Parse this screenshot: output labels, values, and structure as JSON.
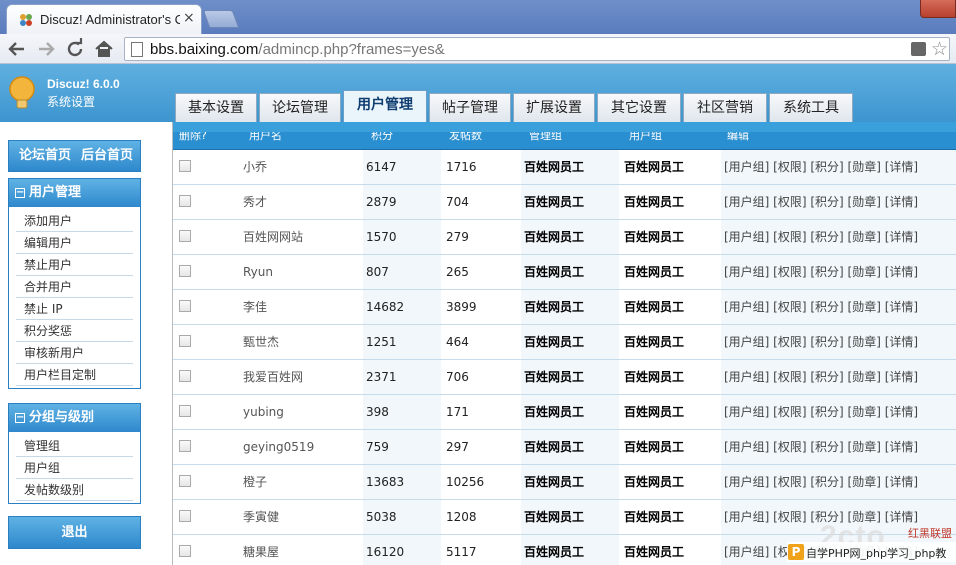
{
  "browser": {
    "tab_title": "Discuz! Administrator's Co",
    "close_glyph": "×",
    "url_host": "bbs.baixing.com",
    "url_path": "/admincp.php?frames=yes&"
  },
  "header": {
    "product": "Discuz! 6.0.0",
    "subtitle": "系统设置",
    "tabs": [
      "基本设置",
      "论坛管理",
      "用户管理",
      "帖子管理",
      "扩展设置",
      "其它设置",
      "社区营销",
      "系统工具"
    ],
    "active_tab": "用户管理"
  },
  "sidebar": {
    "quick_links": [
      "论坛首页",
      "后台首页"
    ],
    "groups": [
      {
        "title": "用户管理",
        "items": [
          "添加用户",
          "编辑用户",
          "禁止用户",
          "合并用户",
          "禁止 IP",
          "积分奖惩",
          "审核新用户",
          "用户栏目定制"
        ]
      },
      {
        "title": "分组与级别",
        "items": [
          "管理组",
          "用户组",
          "发帖数级别"
        ]
      }
    ],
    "logout": "退出"
  },
  "table": {
    "headers": [
      "删除?",
      "用户名",
      "积分",
      "发帖数",
      "管理组",
      "用户组",
      "编辑"
    ],
    "edit_links": "[用户组] [权限] [积分] [勋章] [详情]",
    "rows": [
      {
        "name": "小乔",
        "credits": "6147",
        "posts": "1716",
        "admin_group": "百姓网员工",
        "user_group": "百姓网员工"
      },
      {
        "name": "秀才",
        "credits": "2879",
        "posts": "704",
        "admin_group": "百姓网员工",
        "user_group": "百姓网员工"
      },
      {
        "name": "百姓网网站",
        "credits": "1570",
        "posts": "279",
        "admin_group": "百姓网员工",
        "user_group": "百姓网员工"
      },
      {
        "name": "Ryun",
        "credits": "807",
        "posts": "265",
        "admin_group": "百姓网员工",
        "user_group": "百姓网员工"
      },
      {
        "name": "李佳",
        "credits": "14682",
        "posts": "3899",
        "admin_group": "百姓网员工",
        "user_group": "百姓网员工"
      },
      {
        "name": "甄世杰",
        "credits": "1251",
        "posts": "464",
        "admin_group": "百姓网员工",
        "user_group": "百姓网员工"
      },
      {
        "name": "我爱百姓网",
        "credits": "2371",
        "posts": "706",
        "admin_group": "百姓网员工",
        "user_group": "百姓网员工"
      },
      {
        "name": "yubing",
        "credits": "398",
        "posts": "171",
        "admin_group": "百姓网员工",
        "user_group": "百姓网员工"
      },
      {
        "name": "geying0519",
        "credits": "759",
        "posts": "297",
        "admin_group": "百姓网员工",
        "user_group": "百姓网员工"
      },
      {
        "name": "橙子",
        "credits": "13683",
        "posts": "10256",
        "admin_group": "百姓网员工",
        "user_group": "百姓网员工"
      },
      {
        "name": "季寅健",
        "credits": "5038",
        "posts": "1208",
        "admin_group": "百姓网员工",
        "user_group": "百姓网员工"
      },
      {
        "name": "糖果屋",
        "credits": "16120",
        "posts": "5117",
        "admin_group": "百姓网员工",
        "user_group": "百姓网员工"
      }
    ]
  },
  "watermark": {
    "logo_text": "2cto",
    "red_label": "红黑联盟",
    "badge": "P",
    "text": "自学PHP网_php学习_php教"
  }
}
